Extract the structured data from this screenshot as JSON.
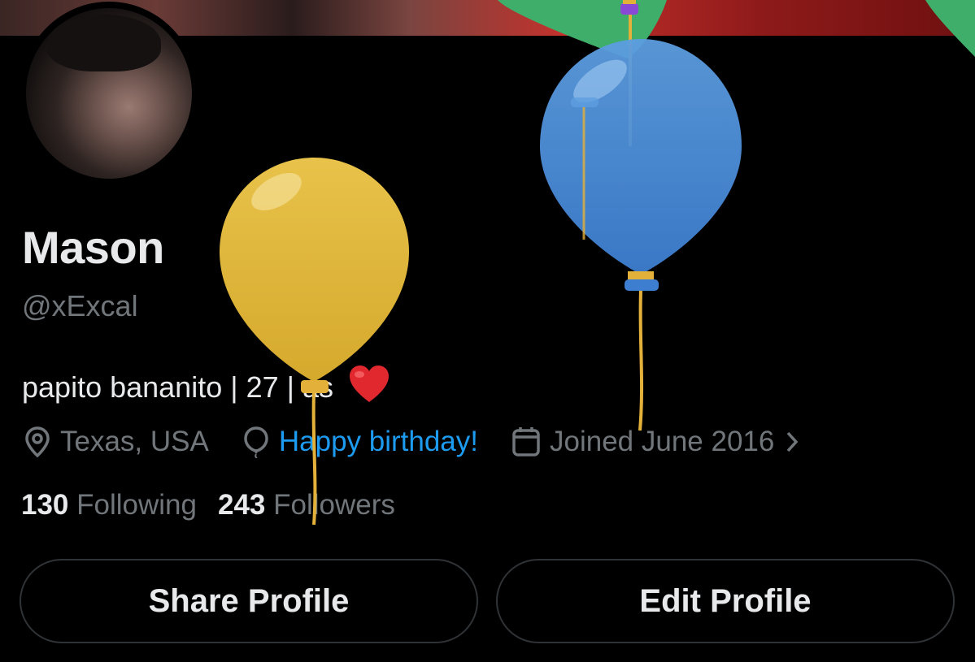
{
  "profile": {
    "name": "Mason",
    "handle": "@xExcal",
    "bio": "papito bananito | 27 | as",
    "location": "Texas, USA",
    "birthday": "Happy birthday!",
    "joined": "Joined June 2016"
  },
  "stats": {
    "following_count": "130",
    "following_label": "Following",
    "followers_count": "243",
    "followers_label": "Followers"
  },
  "actions": {
    "share_label": "Share Profile",
    "edit_label": "Edit Profile"
  },
  "icons": {
    "location": "location-pin-icon",
    "birthday": "balloon-icon",
    "joined": "calendar-icon",
    "chevron": "chevron-right-icon",
    "bio_emoji": "red-heart-emoji"
  },
  "colors": {
    "background": "#000000",
    "text_primary": "#e7e9ea",
    "text_secondary": "#71767b",
    "link": "#1d9bf0",
    "border": "#2f3336",
    "balloon_yellow": "#e0b83a",
    "balloon_blue": "#4d8fd9",
    "balloon_green": "#3fae6a"
  }
}
